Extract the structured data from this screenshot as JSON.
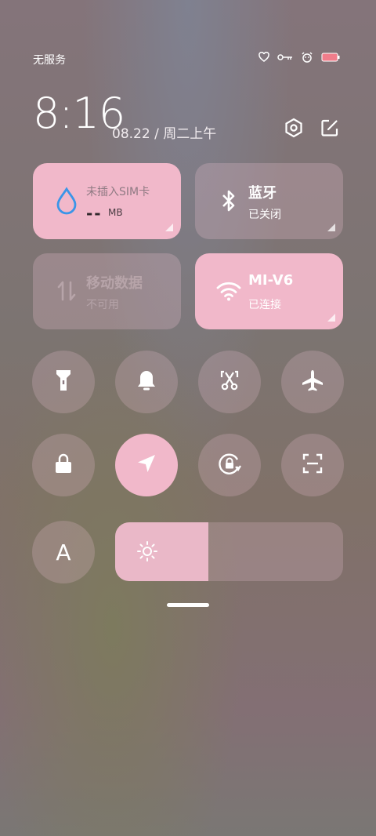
{
  "status_bar": {
    "carrier": "无服务",
    "icons": [
      "heart-chat-icon",
      "key-icon",
      "alarm-face-icon",
      "battery-icon"
    ],
    "battery_color": "#f07d8b"
  },
  "header": {
    "time": "8:16",
    "date": "08.22 / 周二上午",
    "icons": [
      "settings-hex-icon",
      "edit-icon"
    ]
  },
  "tiles": {
    "sim": {
      "label": "未插入SIM卡",
      "value": "--",
      "unit": "MB",
      "icon": "water-drop-icon",
      "icon_color": "#3a95e8"
    },
    "bluetooth": {
      "title": "蓝牙",
      "status": "已关闭",
      "icon": "bluetooth-icon"
    },
    "mobile_data": {
      "title": "移动数据",
      "status": "不可用",
      "icon": "data-arrows-icon"
    },
    "wifi": {
      "title": "MI-V6",
      "status": "已连接",
      "icon": "wifi-icon"
    }
  },
  "toggles_row1": [
    {
      "name": "flashlight-icon",
      "on": false
    },
    {
      "name": "bell-icon",
      "on": false
    },
    {
      "name": "screenshot-scissor-icon",
      "on": false
    },
    {
      "name": "airplane-icon",
      "on": false
    }
  ],
  "toggles_row2": [
    {
      "name": "lock-icon",
      "on": false
    },
    {
      "name": "location-icon",
      "on": true
    },
    {
      "name": "rotation-lock-icon",
      "on": false
    },
    {
      "name": "scan-icon",
      "on": false
    }
  ],
  "auto_brightness_label": "A",
  "brightness": {
    "level": 0.41,
    "icon": "sun-icon"
  },
  "accent_color": "#f1b8ca"
}
